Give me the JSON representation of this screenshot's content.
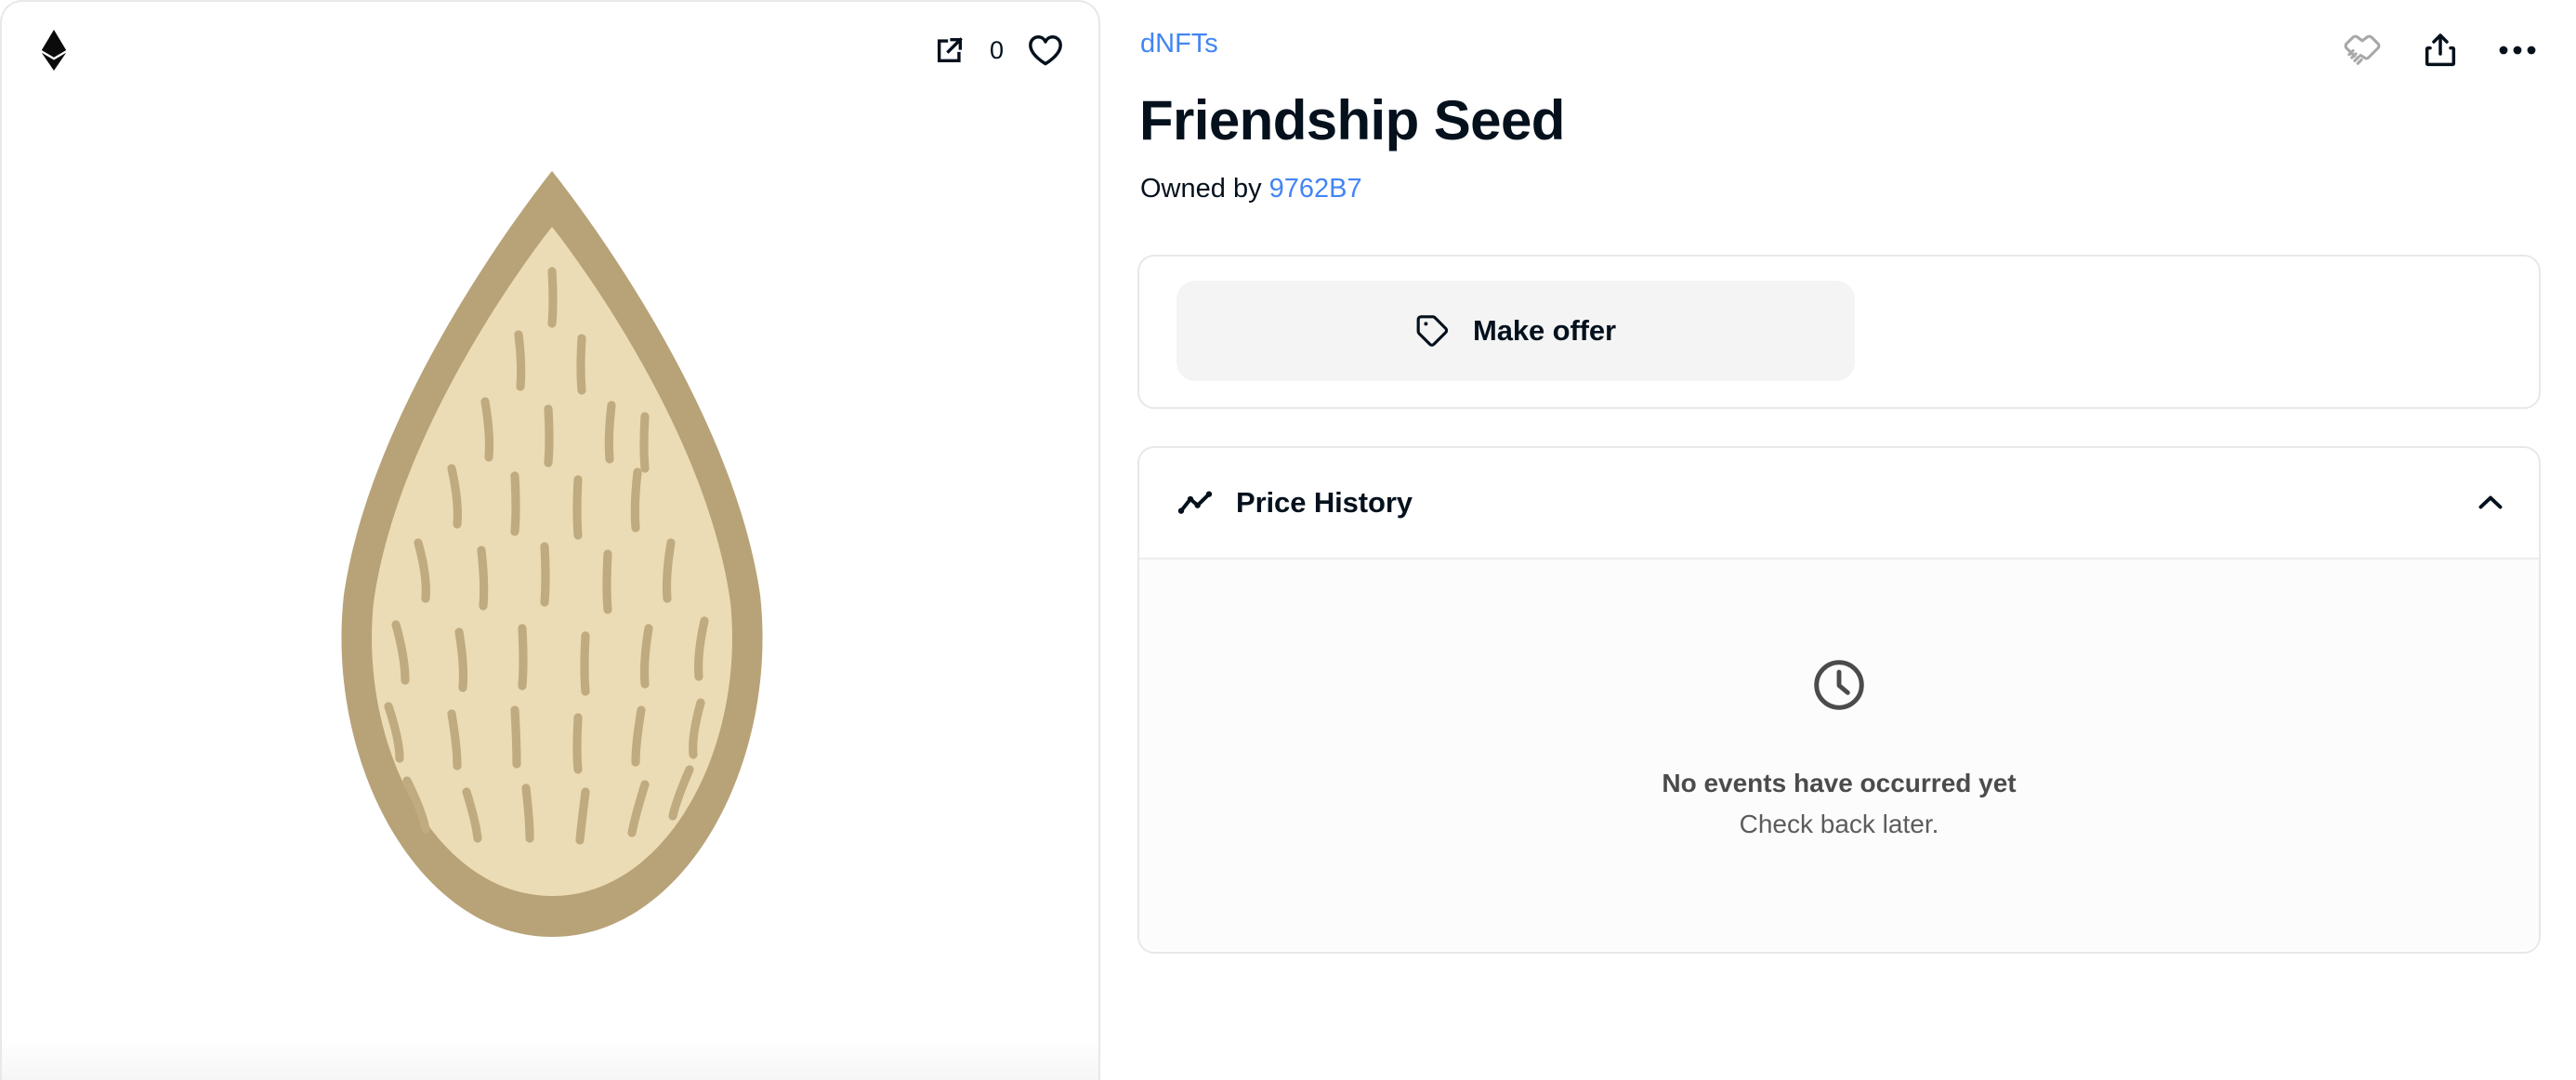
{
  "asset_panel": {
    "chain_icon": "ethereum-logo",
    "external_link_icon": "external-link-icon",
    "like_count": "0",
    "favorite_icon": "heart-icon",
    "artwork": {
      "name": "friendship-seed-artwork",
      "alt": "Friendship Seed",
      "outline_color": "#b8a378",
      "fill_color": "#ecdcb5",
      "dash_color": "#c0ab80"
    }
  },
  "detail": {
    "collection": "dNFTs",
    "title": "Friendship Seed",
    "owned_by_label": "Owned by",
    "owner": "9762B7",
    "actions": {
      "offers_icon": "handshake-icon",
      "share_icon": "share-icon",
      "more_icon": "more-horizontal-icon"
    },
    "offer": {
      "button_label": "Make offer",
      "button_icon": "tag-icon"
    },
    "price_history": {
      "icon": "activity-line-chart-icon",
      "title": "Price History",
      "collapse_icon": "chevron-up-icon",
      "empty": {
        "icon": "clock-icon",
        "title": "No events have occurred yet",
        "subtitle": "Check back later."
      }
    }
  },
  "colors": {
    "link": "#4285f4",
    "text": "#04111d",
    "border": "#e8e8e8",
    "button_bg": "#f4f4f4",
    "muted": "#8c8c8c"
  }
}
